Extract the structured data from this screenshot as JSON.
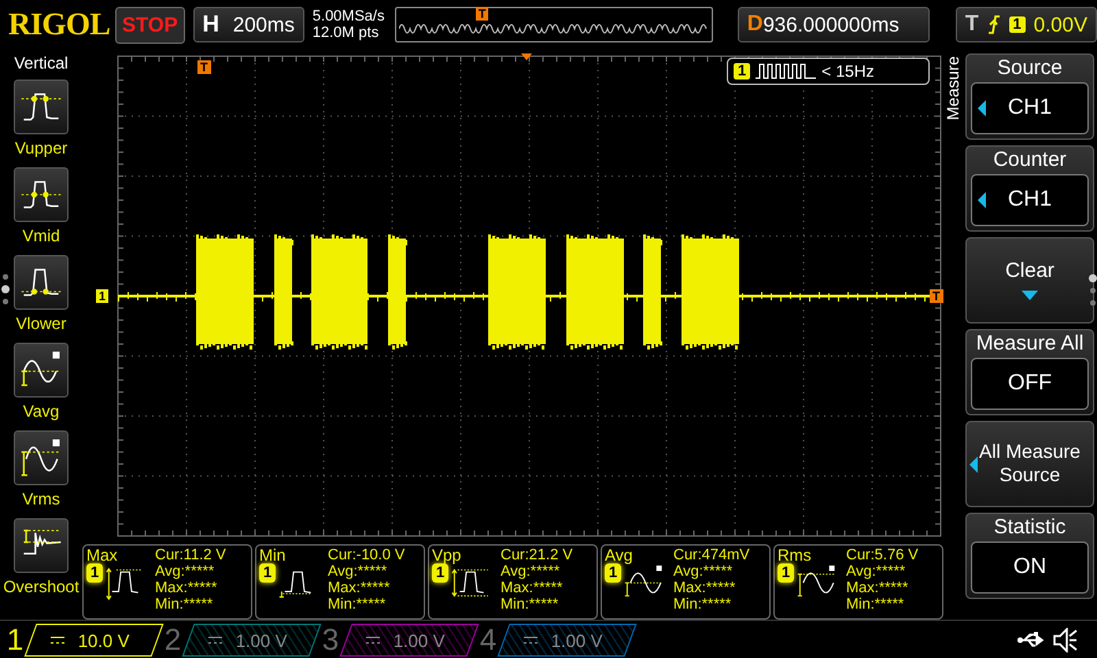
{
  "header": {
    "brand": "RIGOL",
    "run_state": "STOP",
    "timebase": {
      "label": "H",
      "value": "200ms"
    },
    "sample_rate": "5.00MSa/s",
    "memory_depth": "12.0M pts",
    "overview_marker": "T",
    "delay": {
      "label": "D",
      "value": "936.000000ms"
    },
    "trigger": {
      "label": "T",
      "source": "1",
      "level": "0.00V"
    }
  },
  "vertical_panel": {
    "title": "Vertical",
    "items": [
      {
        "label": "Vupper",
        "kind": "vupper"
      },
      {
        "label": "Vmid",
        "kind": "vmid"
      },
      {
        "label": "Vlower",
        "kind": "vlower"
      },
      {
        "label": "Vavg",
        "kind": "vavg"
      },
      {
        "label": "Vrms",
        "kind": "vrms"
      },
      {
        "label": "Overshoot",
        "kind": "overshoot"
      }
    ]
  },
  "display": {
    "trigger_marker": "T",
    "channel_marker": "1",
    "trigger_level_marker": "T",
    "counter": {
      "channel": "1",
      "reading": "< 15Hz"
    }
  },
  "measurements": [
    {
      "name": "Max",
      "kind": "max",
      "channel": "1",
      "current": "Cur:11.2 V",
      "avg": "Avg:*****",
      "max": "Max:*****",
      "min": "Min:*****"
    },
    {
      "name": "Min",
      "kind": "min",
      "channel": "1",
      "current": "Cur:-10.0 V",
      "avg": "Avg:*****",
      "max": "Max:*****",
      "min": "Min:*****"
    },
    {
      "name": "Vpp",
      "kind": "vpp",
      "channel": "1",
      "current": "Cur:21.2 V",
      "avg": "Avg:*****",
      "max": "Max:*****",
      "min": "Min:*****"
    },
    {
      "name": "Avg",
      "kind": "avg",
      "channel": "1",
      "current": "Cur:474mV",
      "avg": "Avg:*****",
      "max": "Max:*****",
      "min": "Min:*****"
    },
    {
      "name": "Rms",
      "kind": "rms",
      "channel": "1",
      "current": "Cur:5.76 V",
      "avg": "Avg:*****",
      "max": "Max:*****",
      "min": "Min:*****"
    }
  ],
  "menu": {
    "title": "Measure",
    "items": [
      {
        "kind": "select",
        "label": "Source",
        "value": "CH1"
      },
      {
        "kind": "select",
        "label": "Counter",
        "value": "CH1"
      },
      {
        "kind": "action",
        "label": "Clear"
      },
      {
        "kind": "value",
        "label": "Measure All",
        "value": "OFF"
      },
      {
        "kind": "submenu",
        "label": "All Measure Source"
      },
      {
        "kind": "value",
        "label": "Statistic",
        "value": "ON"
      }
    ]
  },
  "channels": [
    {
      "number": "1",
      "scale": "10.0 V",
      "on": true,
      "color": "#f0f000"
    },
    {
      "number": "2",
      "scale": "1.00 V",
      "on": false,
      "color": "#007878"
    },
    {
      "number": "3",
      "scale": "1.00 V",
      "on": false,
      "color": "#a000a0"
    },
    {
      "number": "4",
      "scale": "1.00 V",
      "on": false,
      "color": "#0068b0"
    }
  ]
}
